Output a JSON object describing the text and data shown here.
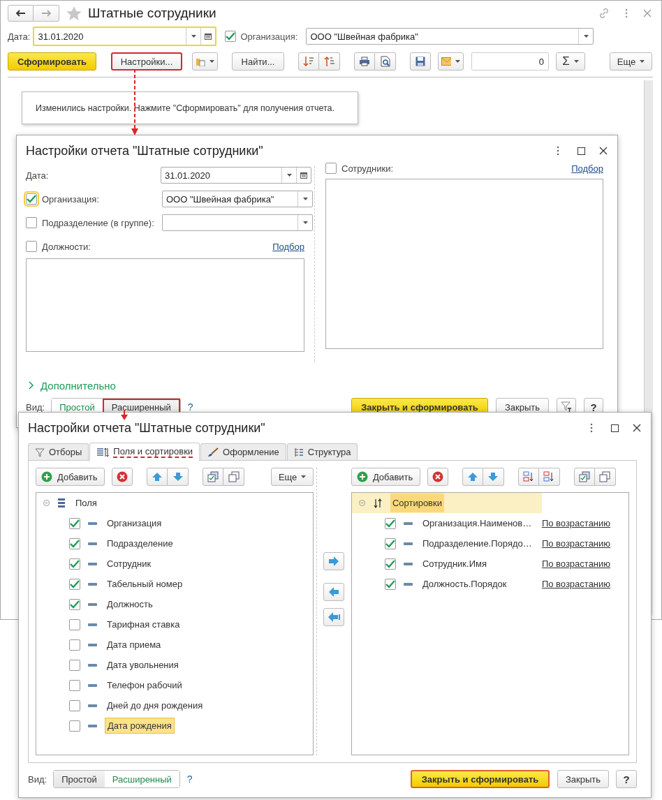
{
  "main": {
    "title": "Штатные сотрудники",
    "date_label": "Дата:",
    "date": "31.01.2020",
    "org_checked": true,
    "org_label": "Организация:",
    "org_value": "ООО \"Швейная фабрика\"",
    "toolbar": {
      "generate": "Сформировать",
      "settings": "Настройки...",
      "settings_annotated": true,
      "find": "Найти...",
      "total": "0",
      "sum": "Σ",
      "more": "Еще"
    },
    "message": "Изменились настройки. Нажмите \"Сформировать\" для получения отчета."
  },
  "settings_dialog": {
    "title": "Настройки отчета \"Штатные сотрудники\"",
    "date": {
      "label": "Дата:",
      "value": "31.01.2020"
    },
    "organization": {
      "label": "Организация:",
      "checked": true,
      "value": "ООО \"Швейная фабрика\""
    },
    "department": {
      "label": "Подразделение (в группе):",
      "checked": false
    },
    "positions": {
      "label": "Должности:",
      "checked": false,
      "pick": "Подбор"
    },
    "employees": {
      "label": "Сотрудники:",
      "checked": false,
      "pick": "Подбор"
    },
    "more": {
      "label": "Дополнительно",
      "expanded": false
    },
    "view_label": "Вид:",
    "view_options": [
      {
        "label": "Простой",
        "selected": true,
        "annotated": false
      },
      {
        "label": "Расширенный",
        "selected": false,
        "annotated": true
      }
    ],
    "help": "?",
    "primary": "Закрыть и сформировать",
    "close": "Закрыть",
    "help_button": "?"
  },
  "advanced_dialog": {
    "title": "Настройки отчета \"Штатные сотрудники\"",
    "tabs": [
      {
        "label": "Отборы",
        "selected": false,
        "annotated": false
      },
      {
        "label": "Поля и сортировки",
        "selected": true,
        "annotated": true
      },
      {
        "label": "Оформление",
        "selected": false,
        "annotated": false
      },
      {
        "label": "Структура",
        "selected": false,
        "annotated": false
      }
    ],
    "fields_toolbar": {
      "add": "Добавить",
      "more": "Еще"
    },
    "fields": {
      "label": "Поля",
      "expanded": true,
      "selected": false,
      "children": [
        {
          "label": "Организация",
          "checked": true,
          "selected": false
        },
        {
          "label": "Подразделение",
          "checked": true,
          "selected": false
        },
        {
          "label": "Сотрудник",
          "checked": true,
          "selected": false
        },
        {
          "label": "Табельный номер",
          "checked": true,
          "selected": false
        },
        {
          "label": "Должность",
          "checked": true,
          "selected": false
        },
        {
          "label": "Тарифная ставка",
          "checked": false,
          "selected": false
        },
        {
          "label": "Дата приема",
          "checked": false,
          "selected": false
        },
        {
          "label": "Дата увольнения",
          "checked": false,
          "selected": false
        },
        {
          "label": "Телефон рабочий",
          "checked": false,
          "selected": false
        },
        {
          "label": "Дней до дня рождения",
          "checked": false,
          "selected": false
        },
        {
          "label": "Дата рождения",
          "checked": false,
          "selected": true
        }
      ]
    },
    "sort_toolbar": {
      "add": "Добавить"
    },
    "sorting": {
      "label": "Сортировки",
      "expanded": true,
      "selected": true,
      "children": [
        {
          "label": "Организация.Наименов…",
          "checked": true,
          "order": "По возрастанию"
        },
        {
          "label": "Подразделение.Порядо…",
          "checked": true,
          "order": "По возрастанию"
        },
        {
          "label": "Сотрудник.Имя",
          "checked": true,
          "order": "По возрастанию"
        },
        {
          "label": "Должность.Порядок",
          "checked": true,
          "order": "По возрастанию"
        }
      ]
    },
    "view_label": "Вид:",
    "view_options": [
      {
        "label": "Простой",
        "selected": false
      },
      {
        "label": "Расширенный",
        "selected": true
      }
    ],
    "help": "?",
    "primary": "Закрыть и сформировать",
    "primary_annotated": true,
    "close": "Закрыть",
    "help_button": "?"
  }
}
